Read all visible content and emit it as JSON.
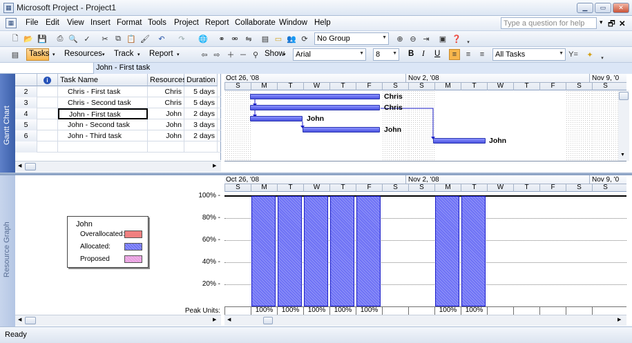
{
  "app": {
    "title": "Microsoft Project - Project1"
  },
  "menu": [
    "File",
    "Edit",
    "View",
    "Insert",
    "Format",
    "Tools",
    "Project",
    "Report",
    "Collaborate",
    "Window",
    "Help"
  ],
  "help_placeholder": "Type a question for help",
  "toolbar": {
    "group_value": "No Group",
    "tasks_label": "Tasks",
    "resources_label": "Resources",
    "track_label": "Track",
    "report_label": "Report",
    "show_label": "Show",
    "font_value": "Arial",
    "size_value": "8",
    "bold": "B",
    "italic": "I",
    "underline": "U",
    "filter_value": "All Tasks"
  },
  "entry_bar": {
    "value": "John - First task"
  },
  "views": {
    "gantt": "Gantt Chart",
    "resource": "Resource Graph"
  },
  "table": {
    "columns": [
      "Task Name",
      "Resources",
      "Duration"
    ],
    "rows": [
      {
        "id": "2",
        "name": "Chris - First task",
        "resource": "Chris",
        "duration": "5 days"
      },
      {
        "id": "3",
        "name": "Chris - Second task",
        "resource": "Chris",
        "duration": "5 days"
      },
      {
        "id": "4",
        "name": "John - First task",
        "resource": "John",
        "duration": "2 days"
      },
      {
        "id": "5",
        "name": "John - Second task",
        "resource": "John",
        "duration": "3 days"
      },
      {
        "id": "6",
        "name": "John - Third task",
        "resource": "John",
        "duration": "2 days"
      }
    ]
  },
  "timescale": {
    "weeks": [
      "Oct 26, '08",
      "Nov 2, '08",
      "Nov 9, '0"
    ],
    "days": [
      "S",
      "M",
      "T",
      "W",
      "T",
      "F",
      "S",
      "S",
      "M",
      "T",
      "W",
      "T",
      "F",
      "S",
      "S"
    ]
  },
  "gantt_labels": [
    "Chris",
    "Chris",
    "John",
    "John",
    "John"
  ],
  "resource_graph": {
    "legend_title": "John",
    "legend_items": [
      {
        "label": "Overallocated:",
        "color": "#f08080"
      },
      {
        "label": "Allocated:",
        "color": "#6e72f5"
      },
      {
        "label": "Proposed",
        "color": "#e89ce0"
      }
    ],
    "y_ticks": [
      "100% -",
      "80% -",
      "60% -",
      "40% -",
      "20% -"
    ],
    "peak_label": "Peak Units:",
    "peak_values": [
      "100%",
      "100%",
      "100%",
      "100%",
      "100%",
      "100%",
      "100%"
    ],
    "allocation_by_day": [
      0,
      1,
      1,
      1,
      1,
      1,
      0,
      0,
      1,
      1,
      0,
      0,
      0,
      0,
      0
    ]
  },
  "status": {
    "text": "Ready"
  }
}
